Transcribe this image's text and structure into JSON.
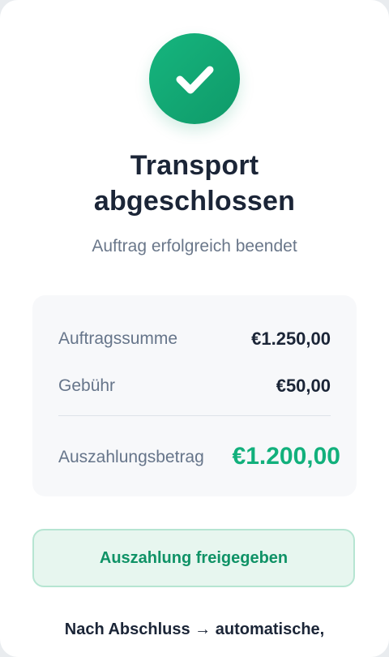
{
  "header": {
    "icon": "checkmark-icon",
    "title": "Transport abgeschlossen",
    "subtitle": "Auftrag erfolgreich beendet"
  },
  "summary": {
    "rows": [
      {
        "label": "Auftragssumme",
        "value": "€1.250,00"
      },
      {
        "label": "Gebühr",
        "value": "€50,00"
      }
    ],
    "payout": {
      "label": "Auszahlungsbetrag",
      "value": "€1.200,00"
    }
  },
  "action": {
    "label": "Auszahlung freigegeben"
  },
  "footer": {
    "note": "Nach Abschluss → automatische,"
  },
  "colors": {
    "accent_green": "#12b07c",
    "button_bg": "#e7f6ef",
    "button_border": "#b6e5d2",
    "text_dark": "#1b2537",
    "text_muted": "#66758a",
    "summary_bg": "#f7f8fa"
  }
}
